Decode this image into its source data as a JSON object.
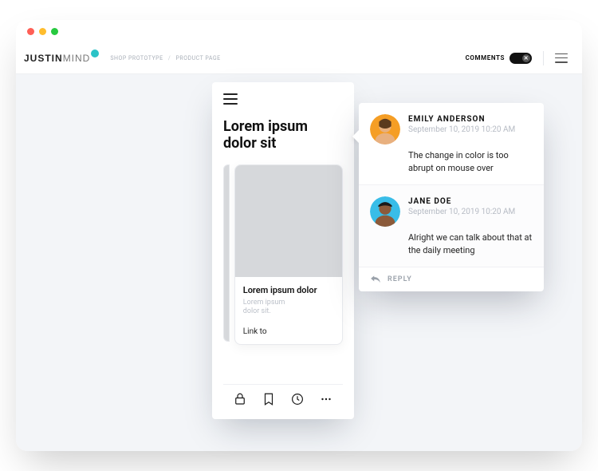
{
  "logo": {
    "bold": "JUSTIN",
    "light": "MIND"
  },
  "breadcrumbs": {
    "a": "SHOP PROTOTYPE",
    "b": "PRODUCT PAGE"
  },
  "topbar": {
    "comments_label": "COMMENTS"
  },
  "device": {
    "title": "Lorem ipsum dolor sit",
    "card": {
      "title": "Lorem ipsum dolor",
      "subtitle": "Lorem ipsum\ndolor sit.",
      "link": "Link to"
    }
  },
  "comments": [
    {
      "name": "EMILY ANDERSON",
      "date": "September 10, 2019 10:20 AM",
      "body": "The change in color is too abrupt on mouse over",
      "avatar_bg": "#f59e25",
      "avatar_skin": "#e8b07f"
    },
    {
      "name": "JANE DOE",
      "date": "September 10, 2019 10:20 AM",
      "body": "Alright we can talk about that at the daily meeting",
      "avatar_bg": "#39bde8",
      "avatar_skin": "#8b5a3a"
    }
  ],
  "reply_label": "REPLY"
}
